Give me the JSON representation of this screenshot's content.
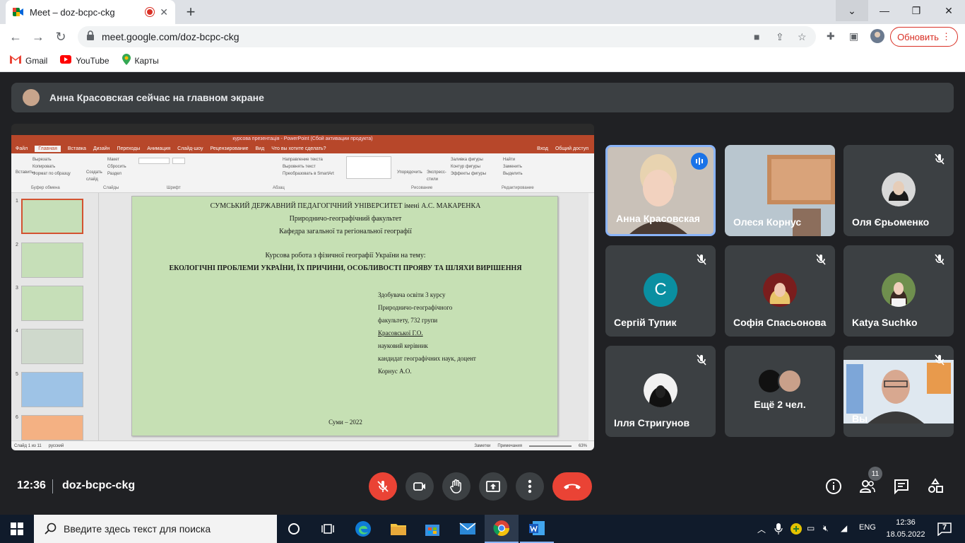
{
  "browser": {
    "tab_title": "Meet – doz-bcpc-ckg",
    "url": "meet.google.com/doz-bcpc-ckg",
    "update_label": "Обновить",
    "bookmarks": [
      "Gmail",
      "YouTube",
      "Карты"
    ]
  },
  "meet": {
    "banner_text": "Анна Красовская сейчас на главном экране",
    "time": "12:36",
    "meeting_code": "doz-bcpc-ckg",
    "people_count": "11",
    "participants": [
      {
        "name": "Анна Красовская",
        "avatar_letter": ""
      },
      {
        "name": "Олеся Корнус",
        "avatar_letter": ""
      },
      {
        "name": "Оля Єрьоменко",
        "avatar_letter": ""
      },
      {
        "name": "Сергій Тупик",
        "avatar_letter": "С"
      },
      {
        "name": "Софія Спасьонова",
        "avatar_letter": ""
      },
      {
        "name": "Katya Suchko",
        "avatar_letter": ""
      },
      {
        "name": "Ілля Стригунов",
        "avatar_letter": ""
      },
      {
        "name": "Ещё 2 чел.",
        "avatar_letter": ""
      },
      {
        "name": "Вы",
        "avatar_letter": ""
      }
    ],
    "colors": {
      "accent": "#8ab4f8",
      "end_call": "#ea4335",
      "muted_mic": "#ea4335"
    }
  },
  "powerpoint": {
    "window_title": "курсова презентація - PowerPoint (Сбой активации продукта)",
    "menu": [
      "Файл",
      "Главная",
      "Вставка",
      "Дизайн",
      "Переходы",
      "Анимация",
      "Слайд-шоу",
      "Рецензирование",
      "Вид",
      "Что вы хотите сделать?"
    ],
    "menu_right": [
      "Вход",
      "Общий доступ"
    ],
    "ribbon": {
      "clipboard": [
        "Вырезать",
        "Копировать",
        "Формат по образцу"
      ],
      "paste": "Вставить",
      "slides": [
        "Макет",
        "Сбросить",
        "Раздел"
      ],
      "create_slide": "Создать слайд",
      "paragraph": [
        "Направление текста",
        "Выровнять текст",
        "Преобразовать в SmartArt"
      ],
      "arrange": "Упорядочить",
      "styles": "Экспресс-стили",
      "shape_fmt": [
        "Заливка фигуры",
        "Контур фигуры",
        "Эффекты фигуры"
      ],
      "edit": [
        "Найти",
        "Заменить",
        "Выделить"
      ],
      "group_labels": [
        "Буфер обмена",
        "Слайды",
        "Шрифт",
        "Абзац",
        "Рисование",
        "Редактирование"
      ]
    },
    "thumb_numbers": [
      "1",
      "2",
      "3",
      "4",
      "5",
      "6"
    ],
    "status": {
      "slide": "Слайд 1 из 11",
      "lang": "русский",
      "notes": "Заметки",
      "comments": "Примечания",
      "zoom": "63%"
    },
    "slide": {
      "line1": "СУМСЬКИЙ ДЕРЖАВНИЙ ПЕДАГОГІЧНИЙ УНІВЕРСИТЕТ імені А.С. МАКАРЕНКА",
      "line2": "Природничо-географічний факультет",
      "line3": "Кафедра загальної та регіональної географії",
      "line4": "Курсова робота з фізичної географії України на тему:",
      "line5": "ЕКОЛОГІЧНІ ПРОБЛЕМИ УКРАЇНИ, ЇХ ПРИЧИНИ, ОСОБЛИВОСТІ ПРОЯВУ ТА ШЛЯХИ ВИРІШЕННЯ",
      "right": [
        "Здобувача освіти 3 курсу",
        "Природничо-географічного",
        "факультету, 732 групи",
        "Красовської Г.О.",
        "науковий керівник",
        "кандидат географічних наук, доцент",
        "Корнус А.О."
      ],
      "footer": "Суми – 2022"
    }
  },
  "taskbar": {
    "search_placeholder": "Введите здесь текст для поиска",
    "lang": "ENG",
    "time": "12:36",
    "date": "18.05.2022",
    "notifications": "7"
  }
}
